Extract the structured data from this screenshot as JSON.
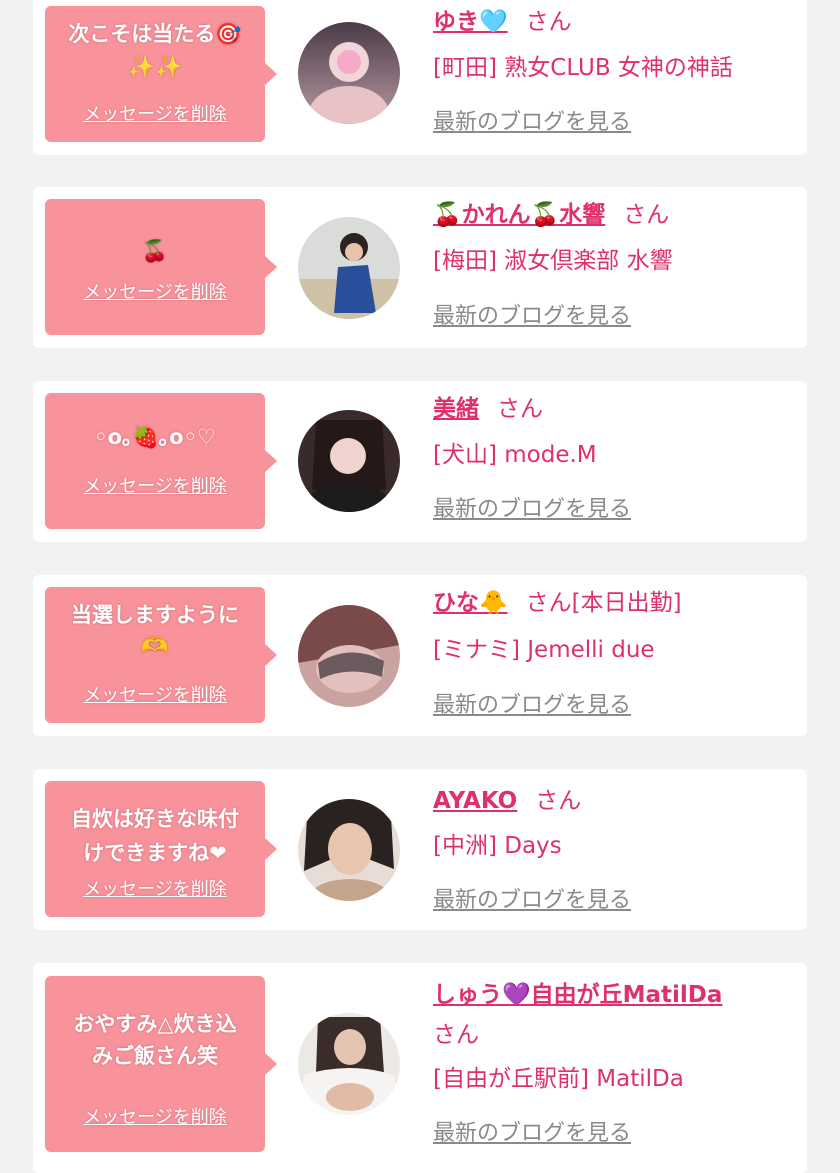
{
  "colors": {
    "page_bg": "#f2f2f2",
    "card_bg": "#ffffff",
    "bubble_bg": "#f8929b",
    "accent": "#e0306a",
    "link_gray": "#8a8a8a"
  },
  "delete_label": "メッセージを削除",
  "blog_label": "最新のブログを見る",
  "entries": [
    {
      "message": "次こそは当たる🎯",
      "message_sub": "✨✨",
      "name": "ゆき🩵",
      "honorific": "さん",
      "shop": "[町田] 熟女CLUB 女神の神話",
      "avatar_icon": "avatar-photo-icon"
    },
    {
      "message": "🍒",
      "message_sub": "",
      "name": "🍒かれん🍒水響",
      "honorific": "さん",
      "shop": "[梅田] 淑女倶楽部 水響",
      "avatar_icon": "avatar-photo-icon"
    },
    {
      "message": "◦o｡🍓｡o◦♡",
      "message_sub": "",
      "name": "美緒",
      "honorific": "さん",
      "shop": "[犬山] mode.M",
      "avatar_icon": "avatar-photo-icon"
    },
    {
      "message": "当選しますように",
      "message_sub": "🫶",
      "name": "ひな🐥",
      "honorific": "さん[本日出勤]",
      "shop": "[ミナミ] Jemelli due",
      "avatar_icon": "avatar-photo-icon"
    },
    {
      "message": "自炊は好きな味付",
      "message_sub": "けできますね❤",
      "name": "AYAKO",
      "honorific": "さん",
      "shop": "[中洲] Days",
      "avatar_icon": "avatar-photo-icon"
    },
    {
      "message": "おやすみ△炊き込",
      "message_sub": "みご飯さん笑",
      "name": "しゅう💜自由が丘MatilDa",
      "honorific": "さん",
      "shop": "[自由が丘駅前] MatilDa",
      "avatar_icon": "avatar-photo-icon"
    }
  ]
}
